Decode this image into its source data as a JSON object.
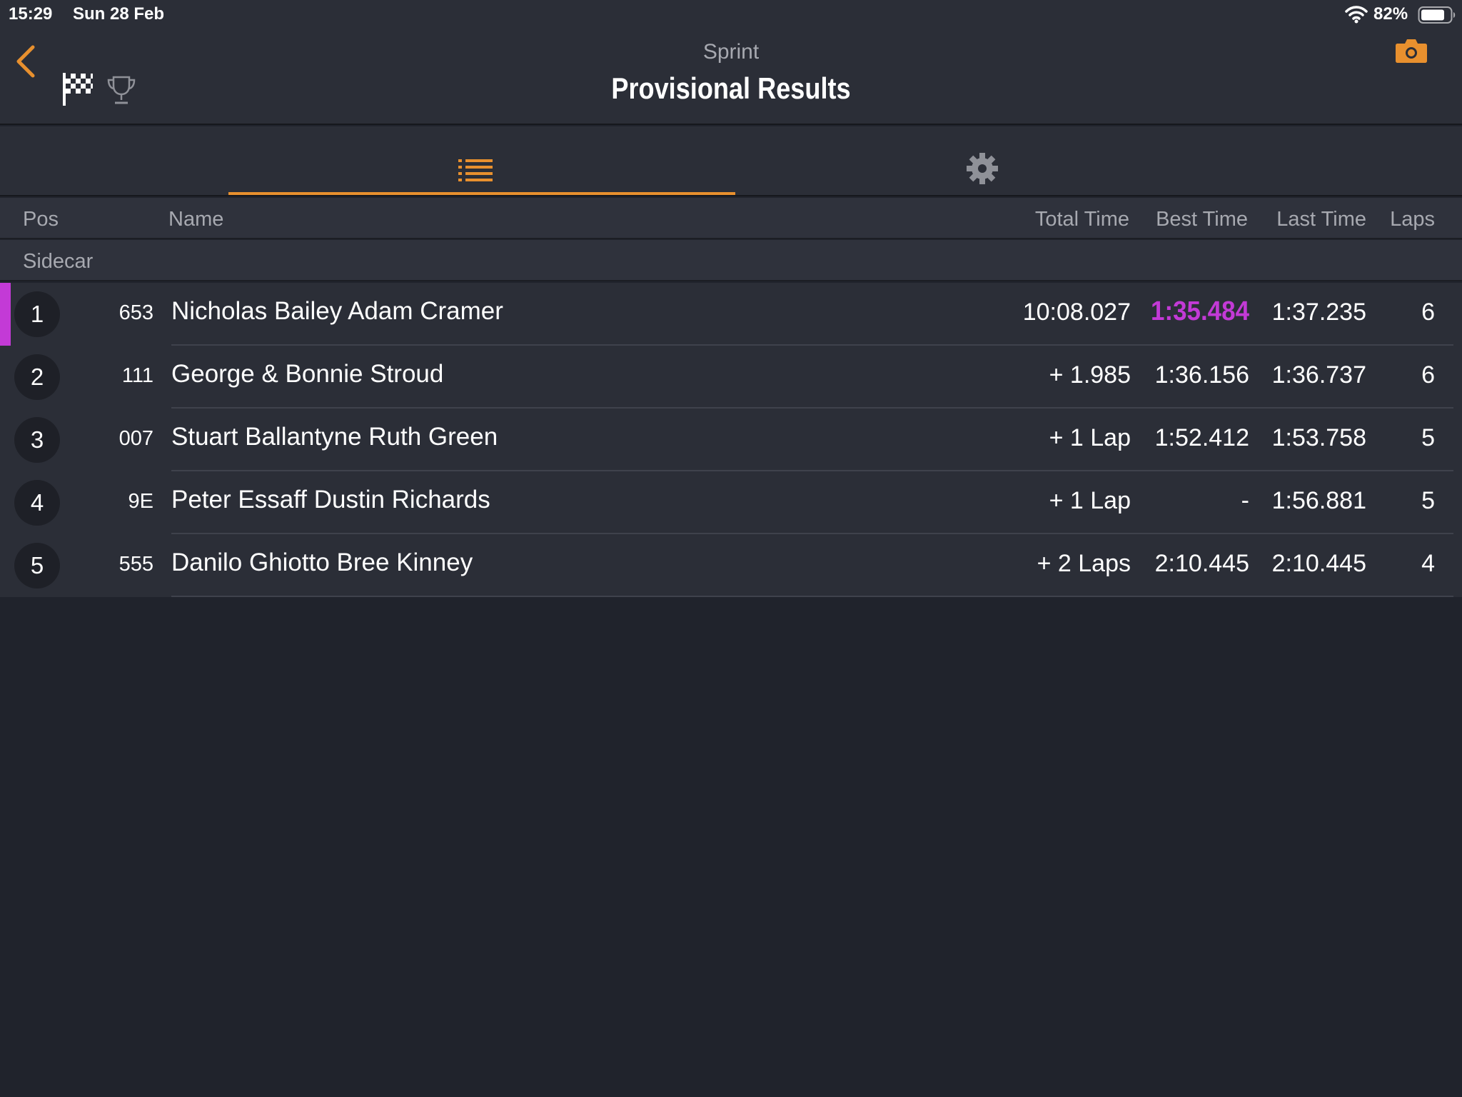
{
  "status_bar": {
    "time": "15:29",
    "date": "Sun 28 Feb",
    "battery_percent": "82%",
    "battery_level": 0.82
  },
  "header": {
    "subtitle": "Sprint",
    "title": "Provisional Results"
  },
  "colors": {
    "accent": "#e8902e",
    "fastest_lap": "#c33ad6",
    "background": "#20232c",
    "row_background": "#2b2e37"
  },
  "tabs": [
    {
      "icon": "list-icon",
      "selected": true
    },
    {
      "icon": "gear-icon",
      "selected": false
    }
  ],
  "columns": {
    "pos": "Pos",
    "name": "Name",
    "total_time": "Total Time",
    "best_time": "Best Time",
    "last_time": "Last Time",
    "laps": "Laps"
  },
  "group": "Sidecar",
  "rows": [
    {
      "pos": "1",
      "number": "653",
      "name": "Nicholas Bailey Adam Cramer",
      "total_time": "10:08.027",
      "best_time": "1:35.484",
      "last_time": "1:37.235",
      "laps": "6"
    },
    {
      "pos": "2",
      "number": "111",
      "name": "George & Bonnie Stroud",
      "total_time": "+ 1.985",
      "best_time": "1:36.156",
      "last_time": "1:36.737",
      "laps": "6"
    },
    {
      "pos": "3",
      "number": "007",
      "name": "Stuart Ballantyne Ruth Green",
      "total_time": "+ 1 Lap",
      "best_time": "1:52.412",
      "last_time": "1:53.758",
      "laps": "5"
    },
    {
      "pos": "4",
      "number": "9E",
      "name": "Peter Essaff Dustin Richards",
      "total_time": "+ 1 Lap",
      "best_time": "-",
      "last_time": "1:56.881",
      "laps": "5"
    },
    {
      "pos": "5",
      "number": "555",
      "name": "Danilo Ghiotto Bree Kinney",
      "total_time": "+ 2 Laps",
      "best_time": "2:10.445",
      "last_time": "2:10.445",
      "laps": "4"
    }
  ]
}
